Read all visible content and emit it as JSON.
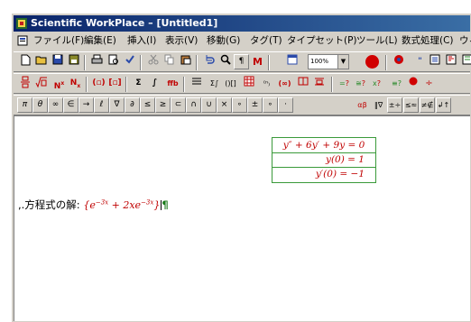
{
  "window": {
    "title": "Scientific WorkPlace – [Untitled1]"
  },
  "menubar": {
    "items": [
      {
        "label": "ファイル(F)"
      },
      {
        "label": "編集(E)"
      },
      {
        "label": "挿入(I)"
      },
      {
        "label": "表示(V)"
      },
      {
        "label": "移動(G)"
      },
      {
        "label": "タグ(T)"
      },
      {
        "label": "タイプセット(P)"
      },
      {
        "label": "ツール(L)"
      },
      {
        "label": "数式処理(C)"
      },
      {
        "label": "ウィンドウ"
      }
    ]
  },
  "toolbar1": {
    "zoom_value": "100%",
    "m_label": "M",
    "paragraph_mark": "¶"
  },
  "toolbar3": {
    "symbols": [
      "π",
      "θ",
      "∞",
      "∈",
      "→",
      "ℓ",
      "∇",
      "∂",
      "≤",
      "≥",
      "⊂",
      "∩",
      "∪",
      "×",
      "∘",
      "±",
      "∘",
      "·"
    ]
  },
  "editor": {
    "equations": {
      "line1": "y″ + 6y′ + 9y = 0",
      "line2": "y(0) = 1",
      "line3": "y′(0) = −1"
    },
    "solution": {
      "prefix": ",.方程式の解:",
      "open": "{e",
      "exp1": "−3x",
      "middle": " + 2xe",
      "exp2": "−3x",
      "close": "}",
      "mark": "¶"
    }
  },
  "colors": {
    "title_bar": "#0a246a",
    "math_text": "#c00000",
    "equation_border": "#3a9a3a",
    "chrome": "#d4d0c8"
  }
}
